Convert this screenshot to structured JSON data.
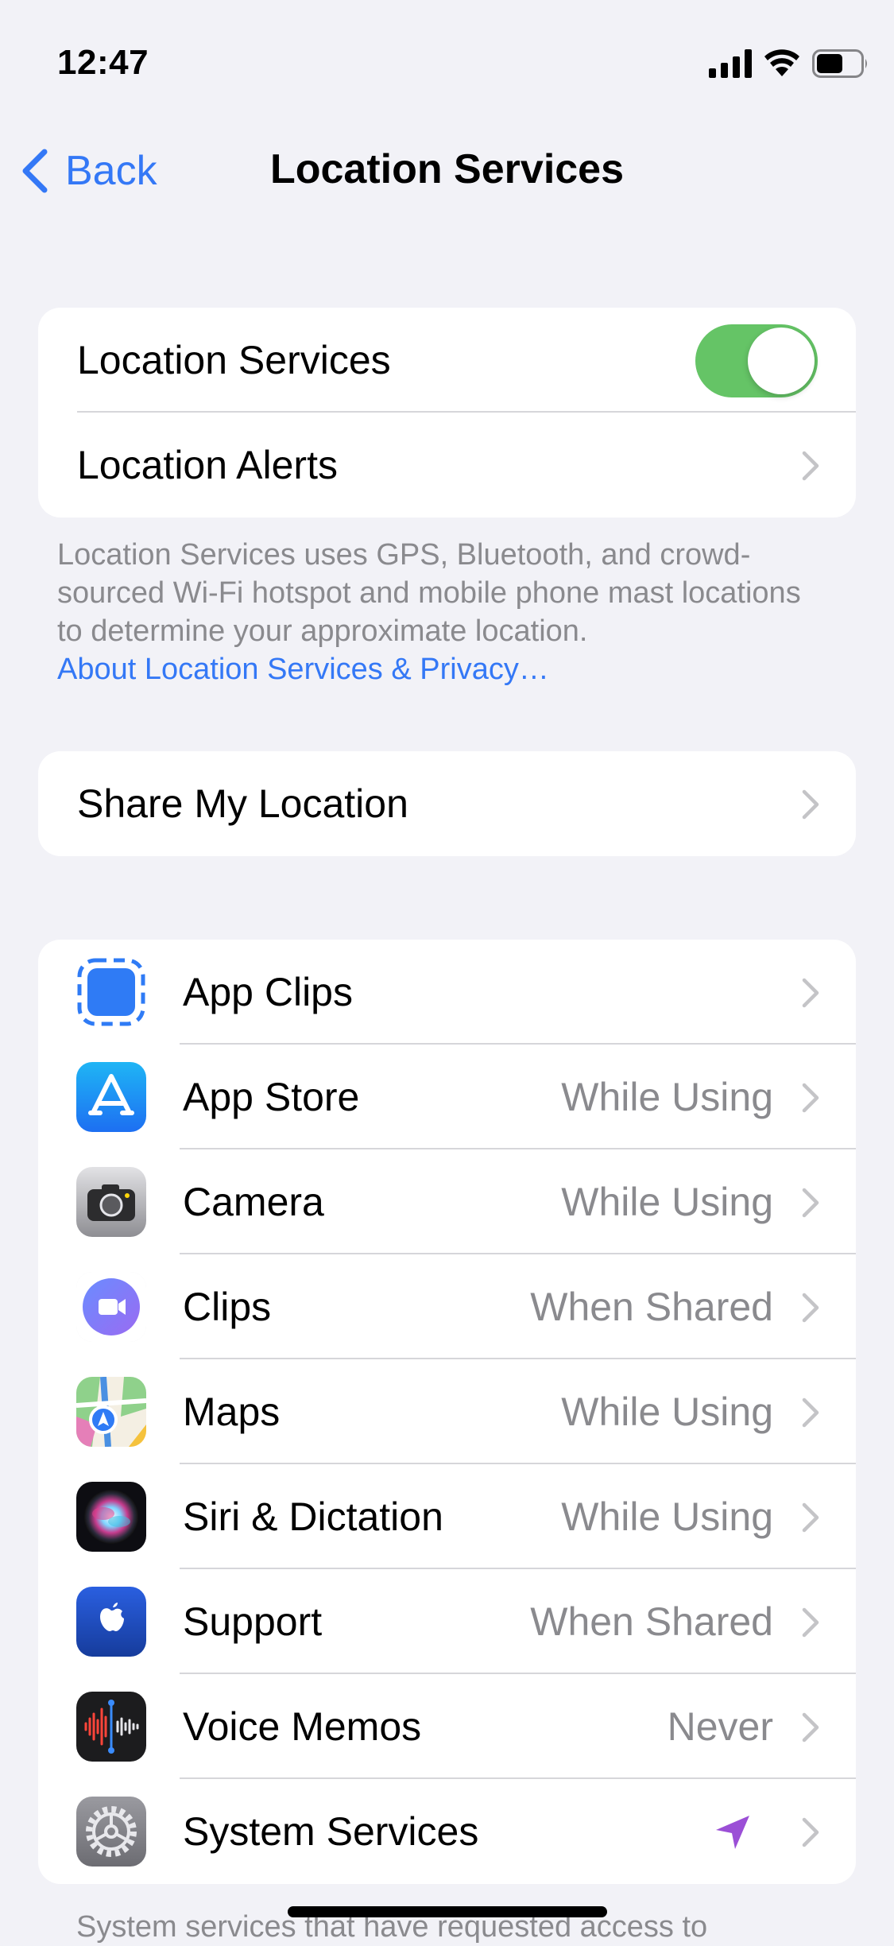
{
  "status_bar": {
    "time": "12:47"
  },
  "nav": {
    "back_label": "Back",
    "title": "Location Services"
  },
  "main_group": {
    "location_services_label": "Location Services",
    "location_services_on": true,
    "location_alerts_label": "Location Alerts"
  },
  "description": {
    "text": "Location Services uses GPS, Bluetooth, and crowd-sourced Wi-Fi hotspot and mobile phone mast locations to determine your approximate location.",
    "link": "About Location Services & Privacy…"
  },
  "share_my_location": {
    "label": "Share My Location"
  },
  "apps": [
    {
      "name": "App Clips",
      "value": "",
      "icon": "app-clips-icon"
    },
    {
      "name": "App Store",
      "value": "While Using",
      "icon": "app-store-icon"
    },
    {
      "name": "Camera",
      "value": "While Using",
      "icon": "camera-icon"
    },
    {
      "name": "Clips",
      "value": "When Shared",
      "icon": "clips-icon"
    },
    {
      "name": "Maps",
      "value": "While Using",
      "icon": "maps-icon"
    },
    {
      "name": "Siri & Dictation",
      "value": "While Using",
      "icon": "siri-icon"
    },
    {
      "name": "Support",
      "value": "When Shared",
      "icon": "support-icon"
    },
    {
      "name": "Voice Memos",
      "value": "Never",
      "icon": "voice-memos-icon"
    },
    {
      "name": "System Services",
      "value": "",
      "icon": "settings-gear-icon",
      "status_icon": "location-arrow-icon"
    }
  ],
  "footer": {
    "text": "System services that have requested access to"
  },
  "colors": {
    "accent": "#3478f6",
    "toggle_on": "#65c466",
    "location_arrow": "#9b4fd6",
    "background": "#f2f2f7"
  }
}
